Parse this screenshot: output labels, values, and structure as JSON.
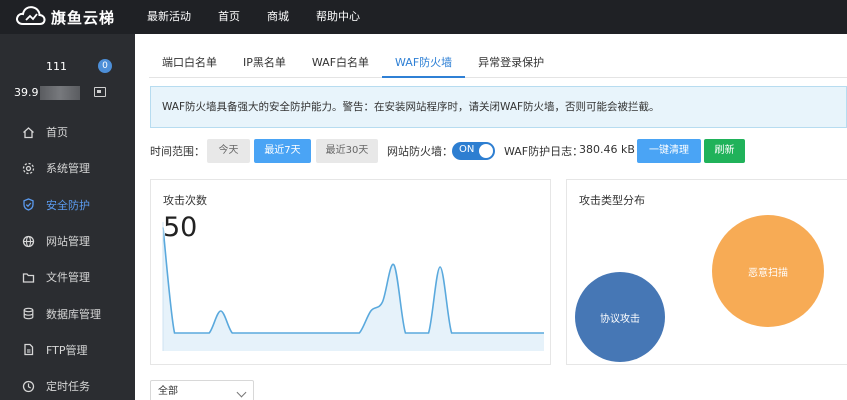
{
  "brand": {
    "name": "旗鱼云梯"
  },
  "topnav": {
    "items": [
      "最新活动",
      "首页",
      "商城",
      "帮助中心"
    ]
  },
  "user": {
    "id": "111",
    "messages": "0",
    "ip_visible": "39.9"
  },
  "sidebar": {
    "items": [
      {
        "label": "首页",
        "icon": "home-icon"
      },
      {
        "label": "系统管理",
        "icon": "gear-icon"
      },
      {
        "label": "安全防护",
        "icon": "shield-icon",
        "active": true
      },
      {
        "label": "网站管理",
        "icon": "globe-icon"
      },
      {
        "label": "文件管理",
        "icon": "folder-icon"
      },
      {
        "label": "数据库管理",
        "icon": "database-icon"
      },
      {
        "label": "FTP管理",
        "icon": "ftp-icon"
      },
      {
        "label": "定时任务",
        "icon": "clock-icon"
      }
    ]
  },
  "tabs": [
    {
      "label": "端口白名单"
    },
    {
      "label": "IP黑名单"
    },
    {
      "label": "WAF白名单"
    },
    {
      "label": "WAF防火墙",
      "active": true
    },
    {
      "label": "异常登录保护"
    }
  ],
  "notice": {
    "text": "WAF防火墙具备强大的安全防护能力。警告：在安装网站程序时，请关闭WAF防火墙，否则可能会被拦截。"
  },
  "toolbar": {
    "time_range_label": "时间范围：",
    "today": "今天",
    "last7": "最近7天",
    "last30": "最近30天",
    "firewall_label": "网站防火墙：",
    "firewall_toggle": "ON",
    "log_label": "WAF防护日志：",
    "log_size": "380.46 kB",
    "clear_button": "一键清理",
    "refresh_button": "刷新"
  },
  "attack_count": {
    "title": "攻击次数",
    "value": "50",
    "chart_data": {
      "type": "area",
      "note_values": [
        48,
        0,
        0,
        0,
        0,
        10,
        0,
        0,
        0,
        0,
        0,
        0,
        0,
        0,
        0,
        0,
        0,
        0,
        10,
        14,
        31,
        0,
        0,
        0,
        30,
        0,
        0,
        0,
        0,
        0,
        0,
        0,
        0,
        0
      ],
      "ylim": [
        0,
        55
      ],
      "color": "#5aa9dd"
    }
  },
  "attack_types": {
    "title": "攻击类型分布",
    "chart_data": {
      "type": "bubble",
      "series": [
        {
          "name": "协议攻击",
          "color": "#4677b5"
        },
        {
          "name": "恶意扫描",
          "color": "#f7ab55"
        }
      ]
    }
  },
  "filter": {
    "selected": "全部"
  },
  "colors": {
    "accent": "#2f80d5",
    "topbar": "#1f2125",
    "sidebar": "#2b2d31",
    "success": "#20b25a"
  }
}
